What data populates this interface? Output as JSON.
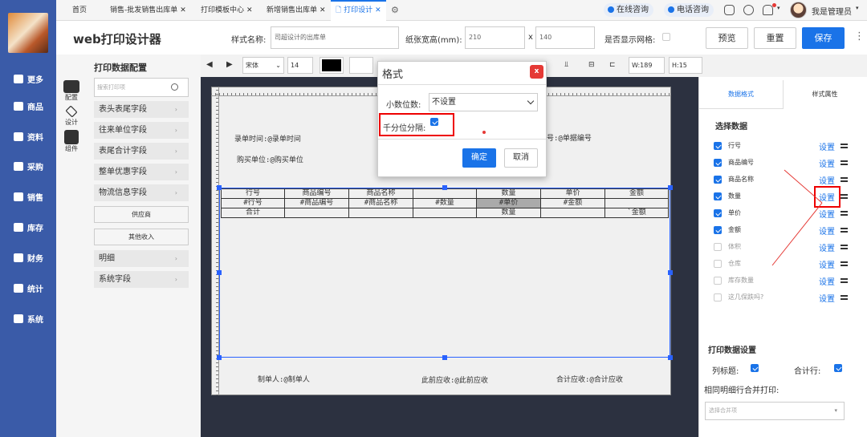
{
  "nav": {
    "items": [
      {
        "label": "更多",
        "icon": "plus-square-icon"
      },
      {
        "label": "商品",
        "icon": "box-icon"
      },
      {
        "label": "资料",
        "icon": "document-icon"
      },
      {
        "label": "采购",
        "icon": "cart-icon"
      },
      {
        "label": "销售",
        "icon": "chart-icon"
      },
      {
        "label": "库存",
        "icon": "warehouse-icon"
      },
      {
        "label": "财务",
        "icon": "finance-icon"
      },
      {
        "label": "统计",
        "icon": "stats-icon"
      },
      {
        "label": "系统",
        "icon": "gear-icon"
      }
    ]
  },
  "tabs": [
    {
      "label": "首页"
    },
    {
      "label": "销售-批发销售出库单"
    },
    {
      "label": "打印模板中心"
    },
    {
      "label": "新增销售出库单"
    },
    {
      "label": "打印设计"
    }
  ],
  "topbar": {
    "online_consult": "在线咨询",
    "phone_consult": "电话咨询",
    "user_name": "我是管理员"
  },
  "header": {
    "title": "web打印设计器",
    "style_name_label": "样式名称:",
    "style_name_value": "司超设计的出库单",
    "paper_size_label": "纸张宽高(mm):",
    "paper_width": "210",
    "paper_x": "x",
    "paper_height": "140",
    "show_grid_label": "是否显示网格:",
    "preview": "预览",
    "reset": "重置",
    "save": "保存"
  },
  "left_panel": {
    "title": "打印数据配置",
    "search_placeholder": "搜索打印项",
    "icons": [
      {
        "label": "配置"
      },
      {
        "label": "设计"
      },
      {
        "label": "组件"
      }
    ],
    "groups": [
      {
        "label": "表头表尾字段"
      },
      {
        "label": "往来单位字段"
      },
      {
        "label": "表尾合计字段"
      },
      {
        "label": "整单优惠字段"
      },
      {
        "label": "物流信息字段"
      }
    ],
    "sub_items": [
      "供应商",
      "其他收入"
    ],
    "groups2": [
      {
        "label": "明细"
      },
      {
        "label": "系统字段"
      }
    ]
  },
  "toolbar": {
    "font": "宋体",
    "font_size": "14",
    "w_label": "W:189",
    "h_label": "H:15"
  },
  "paper": {
    "entry_time": "录单时间:@录单时间",
    "buyer": "购买单位:@购买单位",
    "bill_no": "号:@单据编号",
    "maker": "制单人:@制单人",
    "prev_receivable": "此前应收:@此前应收",
    "total_receivable": "合计应收:@合计应收",
    "table": {
      "header": [
        "行号",
        "商品编号",
        "商品名称",
        "",
        "数量",
        "单价",
        "金额"
      ],
      "row1": [
        "#行号",
        "#商品编号",
        "#商品名称",
        "#数量",
        "#单价",
        "#金额",
        ""
      ],
      "row2": [
        "合计",
        "",
        "",
        "",
        "数量",
        "",
        "`金额"
      ]
    }
  },
  "right_panel": {
    "tab_data_format": "数据格式",
    "tab_style_attr": "样式属性",
    "select_data_title": "选择数据",
    "items": [
      {
        "label": "行号",
        "checked": true
      },
      {
        "label": "商品编号",
        "checked": true
      },
      {
        "label": "商品名称",
        "checked": true
      },
      {
        "label": "数量",
        "checked": true
      },
      {
        "label": "单价",
        "checked": true
      },
      {
        "label": "金额",
        "checked": true
      },
      {
        "label": "体积",
        "checked": false
      },
      {
        "label": "仓库",
        "checked": false
      },
      {
        "label": "库存数量",
        "checked": false
      },
      {
        "label": "这几保跌吗?",
        "checked": false
      }
    ],
    "set_label": "设置",
    "print_settings_title": "打印数据设置",
    "col_title_label": "列标题:",
    "total_row_label": "合计行:",
    "merge_label": "相同明细行合并打印:",
    "merge_placeholder": "选择合并项"
  },
  "dialog": {
    "title": "格式",
    "close": "x",
    "decimals_label": "小数位数:",
    "decimals_value": "不设置",
    "thousands_label": "千分位分隔:",
    "confirm": "确定",
    "cancel": "取消"
  }
}
